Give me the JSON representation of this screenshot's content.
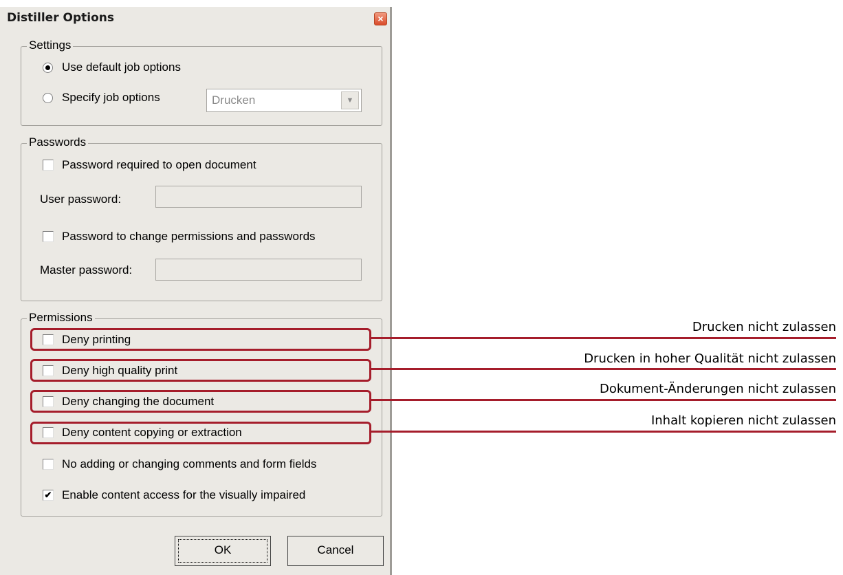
{
  "dialog": {
    "title": "Distiller Options",
    "close_glyph": "×",
    "settings": {
      "label": "Settings",
      "use_default": "Use default job options",
      "specify": "Specify job options",
      "joboptions_value": "Drucken",
      "selected": "use_default"
    },
    "passwords": {
      "label": "Passwords",
      "open_required": "Password required to open document",
      "user_password_label": "User password:",
      "change_permissions": "Password to change permissions and passwords",
      "master_password_label": "Master password:"
    },
    "permissions": {
      "label": "Permissions",
      "deny_printing": "Deny printing",
      "deny_high_quality": "Deny high quality print",
      "deny_changing": "Deny changing the document",
      "deny_copying": "Deny content copying or extraction",
      "no_comments": "No adding or changing comments and form fields",
      "enable_access": "Enable content access for the visually impaired",
      "enable_access_checked": true
    },
    "ok_label": "OK",
    "cancel_label": "Cancel"
  },
  "annotations": {
    "printing": "Drucken nicht zulassen",
    "high_quality": "Drucken in hoher Qualität nicht zulassen",
    "changing": "Dokument-Änderungen nicht zulassen",
    "copying": "Inhalt kopieren nicht zulassen"
  },
  "colors": {
    "highlight": "#a51d2b",
    "dialog_bg": "#ebe9e4"
  }
}
